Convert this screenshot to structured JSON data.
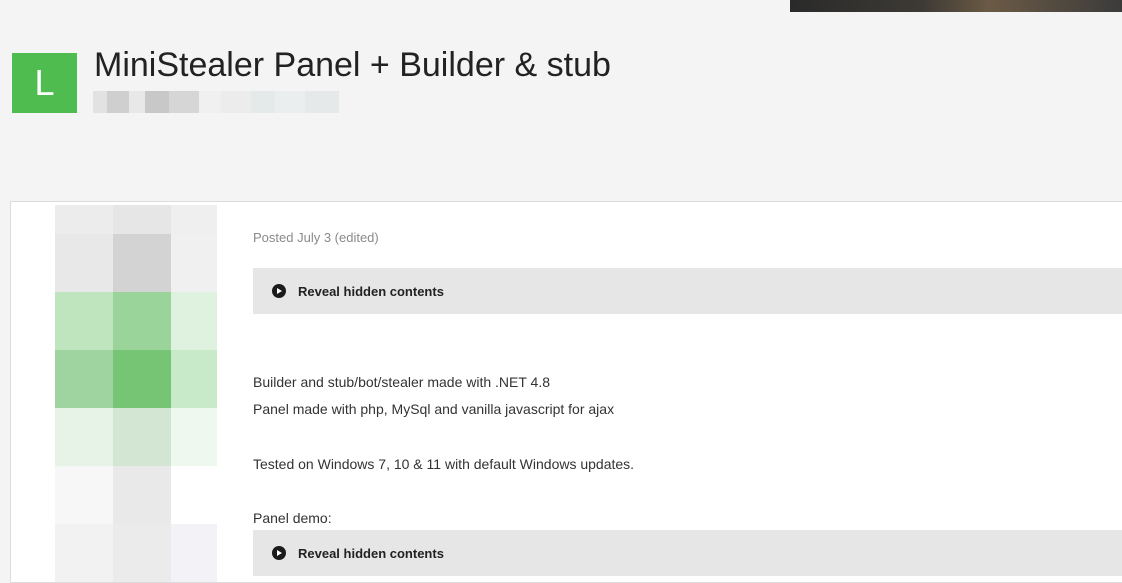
{
  "header": {
    "avatar_letter": "L",
    "title": "MiniStealer Panel + Builder & stub"
  },
  "post": {
    "meta": "Posted July 3 (edited)",
    "reveal_label": "Reveal hidden contents",
    "lines": [
      "Builder and stub/bot/stealer made with .NET 4.8",
      "Panel made with php, MySql and vanilla javascript for ajax",
      "Tested on Windows 7, 10 & 11 with default Windows updates.",
      "Panel demo:"
    ]
  },
  "colors": {
    "accent_green": "#4ebc4e",
    "reveal_bg": "#e6e6e6"
  },
  "icons": {
    "reveal": "circle-chevron-right-icon"
  }
}
